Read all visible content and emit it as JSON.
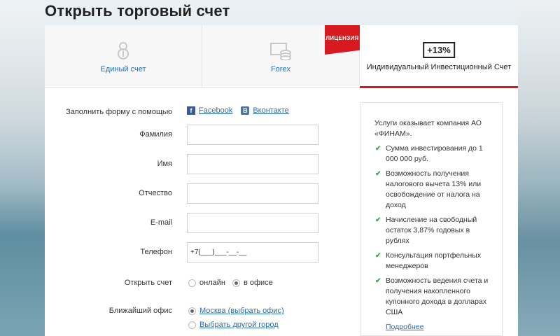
{
  "title": "Открыть торговый счет",
  "tabs": [
    {
      "label": "Единый счет",
      "icon": "piggy-bank-icon"
    },
    {
      "label": "Forex",
      "icon": "coins-icon",
      "ribbon": "ЛИЦЕНЗИЯ"
    },
    {
      "label": "Индивидуальный Инвестиционный Счет",
      "badge": "+13%"
    }
  ],
  "form": {
    "social_label": "Заполнить форму с помощью",
    "facebook": "Facebook",
    "vkontakte": "Вконтакте",
    "surname_label": "Фамилия",
    "name_label": "Имя",
    "patronymic_label": "Отчество",
    "email_label": "E-mail",
    "phone_label": "Телефон",
    "phone_value": "+7(___)___-__-__",
    "open_account_label": "Открыть счет",
    "open_online": "онлайн",
    "open_office": "в офисе",
    "nearest_office_label": "Ближайший офис",
    "office_moscow": "Москва (выбрать офис)",
    "office_other": "Выбрать другой город"
  },
  "sidebar": {
    "intro": "Услуги оказывает компания АО «ФИНАМ».",
    "items": [
      "Сумма инвестирования до 1 000 000 руб.",
      "Возможность получения налогового вычета 13% или освобождение от налога на доход",
      "Начисление на свободный остаток 3,87% годовых в рублях",
      "Консультация портфельных менеджеров",
      "Возможность ведения счета и получения накопленного купонного дохода в долларах США"
    ],
    "more": "Подробнее"
  },
  "colors": {
    "accent": "#d71920",
    "link": "#2a6fb0",
    "check": "#3aa64a"
  }
}
